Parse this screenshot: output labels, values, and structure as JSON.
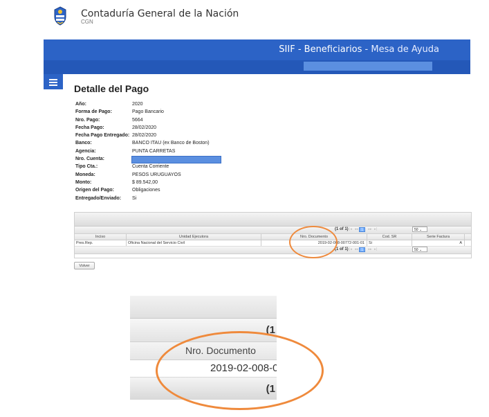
{
  "header": {
    "org_name": "Contaduría General de la Nación",
    "org_short": "CGN",
    "app_title_bold": "SIIF - Beneficiarios",
    "app_title_light": " - Mesa de Ayuda"
  },
  "page": {
    "title": "Detalle del Pago"
  },
  "detail": [
    {
      "label": "Año:",
      "value": "2020"
    },
    {
      "label": "Forma de Pago:",
      "value": "Pago Bancario"
    },
    {
      "label": "Nro. Pago:",
      "value": "5664"
    },
    {
      "label": "Fecha Pago:",
      "value": "28/02/2020"
    },
    {
      "label": "Fecha Pago Entregado:",
      "value": "28/02/2020"
    },
    {
      "label": "Banco:",
      "value": "BANCO ITAU (ex Banco de Boston)"
    },
    {
      "label": "Agencia:",
      "value": "PUNTA CARRETAS"
    },
    {
      "label": "Nro. Cuenta:",
      "value": ""
    },
    {
      "label": "Tipo Cta.:",
      "value": "Cuenta Corriente"
    },
    {
      "label": "Moneda:",
      "value": "PESOS URUGUAYOS"
    },
    {
      "label": "Monto:",
      "value": "$ 89.542,00"
    },
    {
      "label": "Origen del Pago:",
      "value": "Obligaciones"
    },
    {
      "label": "Entregado/Enviado:",
      "value": "Si"
    }
  ],
  "table": {
    "paginator_text": "(1 of 1)",
    "current_page": "1",
    "rows_per_page": "50",
    "columns": [
      "Inciso",
      "Unidad Ejecutora",
      "Nro. Documento",
      "Cod. SR",
      "Serie Factura"
    ],
    "rows": [
      [
        "Pres.Rep.",
        "Oficina Nacional del Servicio Civil",
        "2019-02-008-00772-001-01",
        "Si",
        "A"
      ]
    ]
  },
  "buttons": {
    "volver": "Volver"
  },
  "zoom": {
    "pager_text": "(1",
    "column_header": "Nro. Documento",
    "cell_value": "2019-02-008-00"
  },
  "colors": {
    "primary_blue": "#2c63c6",
    "highlight_orange": "#ef8a3c",
    "redaction": "#5b8fe0"
  }
}
